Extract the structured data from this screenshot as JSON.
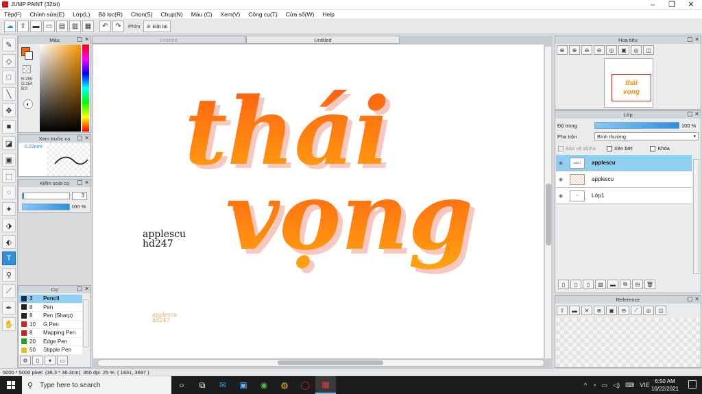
{
  "window": {
    "title": "JUMP PAINT (32bit)"
  },
  "menubar": {
    "items": [
      "Tệp(F)",
      "Chỉnh sửa(E)",
      "Lớp(L)",
      "Bộ lọc(R)",
      "Chọn(S)",
      "Chụp(N)",
      "Màu (C)",
      "Xem(V)",
      "Công cụ(T)",
      "Cửa sổ(W)",
      "Help"
    ]
  },
  "toolbar": {
    "key_label": "Phím",
    "reset_label": "Đặt lại"
  },
  "color_panel": {
    "title": "Màu",
    "r": "R:255",
    "g": "G:154",
    "b": "B:0",
    "foreground": "#ff6a00",
    "background": "#ffffff"
  },
  "preview_panel": {
    "title": "Xem trước cọ",
    "size": "0.22mm"
  },
  "control_panel": {
    "title": "Kiểm soát cọ",
    "size_value": "3",
    "opacity_value": "100 %"
  },
  "brush_panel": {
    "title": "Cọ",
    "brushes": [
      {
        "size": "3",
        "name": "Pencil",
        "color": "#1a2a50"
      },
      {
        "size": "8",
        "name": "Pen",
        "color": "#222222"
      },
      {
        "size": "8",
        "name": "Pen (Sharp)",
        "color": "#222222"
      },
      {
        "size": "10",
        "name": "G Pen",
        "color": "#d02020"
      },
      {
        "size": "8",
        "name": "Mapping Pen",
        "color": "#d02020"
      },
      {
        "size": "20",
        "name": "Edge Pen",
        "color": "#20a020"
      },
      {
        "size": "50",
        "name": "Stipple Pen",
        "color": "#e0c020"
      }
    ]
  },
  "document": {
    "tabs": [
      "Untitled",
      "Untitled"
    ],
    "canvas_text": {
      "main_line1": "thái",
      "main_line2": "vọng",
      "sig_line1": "applescu",
      "sig_line2": "hd247",
      "small_line1": "applescu",
      "small_line2": "hd247"
    }
  },
  "navigator": {
    "title": "Hoa tiêu"
  },
  "layer_panel": {
    "title": "Lớp",
    "opacity_label": "Độ trong",
    "opacity_value": "100 %",
    "blend_label": "Pha trộn",
    "blend_value": "Bình thường",
    "protect_alpha": "Bảo vệ alpha",
    "clipping": "Xén bớt",
    "lock": "Khóa",
    "layers": [
      {
        "name": "applescu",
        "thumb": "hd247"
      },
      {
        "name": "applescu",
        "thumb": ""
      },
      {
        "name": "Lớp1",
        "thumb": ""
      }
    ]
  },
  "reference_panel": {
    "title": "Reference"
  },
  "statusbar": {
    "size": "5000 * 5000 pixel",
    "physical": "(36.3 * 36.3cm)",
    "dpi": "350 dpi",
    "zoom": "25 %",
    "coords": "( 1831, 3697 )"
  },
  "taskbar": {
    "search_placeholder": "Type here to search",
    "lang": "VIE",
    "time": "6:50 AM",
    "date": "10/22/2021"
  }
}
